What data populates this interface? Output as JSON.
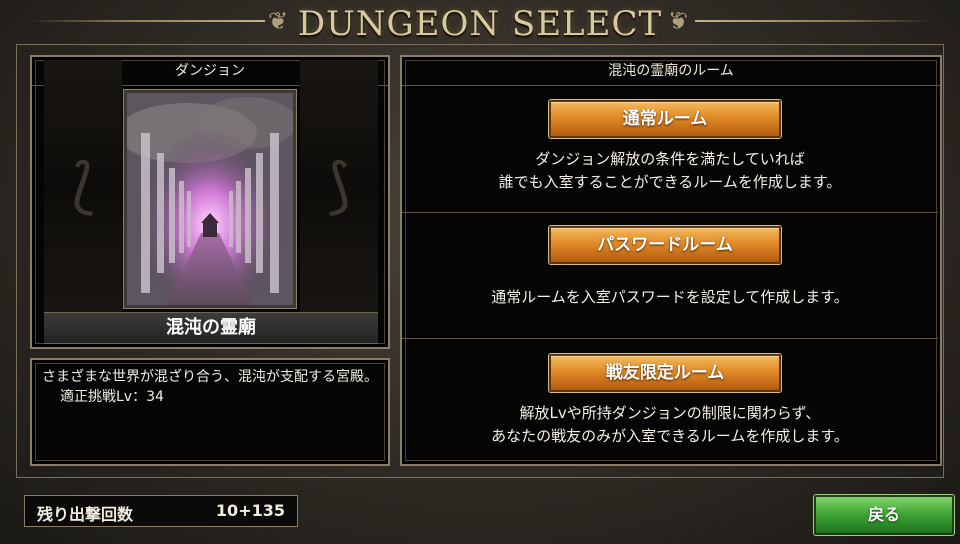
{
  "header": {
    "title": "DUNGEON SELECT"
  },
  "left_panel": {
    "header": "ダンジョン",
    "dungeon_name": "混沌の霊廟",
    "description": "さまざまな世界が混ざり合う、混沌が支配する宮殿。",
    "recommended_level": "適正挑戦Lv：34"
  },
  "right_panel": {
    "header": "混沌の霊廟のルーム",
    "rooms": [
      {
        "label": "通常ルーム",
        "desc_line1": "ダンジョン解放の条件を満たしていれば",
        "desc_line2": "誰でも入室することができるルームを作成します。"
      },
      {
        "label": "パスワードルーム",
        "desc_line1": "通常ルームを入室パスワードを設定して作成します。",
        "desc_line2": ""
      },
      {
        "label": "戦友限定ルーム",
        "desc_line1": "解放Lvや所持ダンジョンの制限に関わらず、",
        "desc_line2": "あなたの戦友のみが入室できるルームを作成します。"
      }
    ]
  },
  "footer": {
    "sortie_label": "残り出撃回数",
    "sortie_value": "10+135",
    "back_label": "戻る"
  },
  "colors": {
    "accent_orange": "#e08a26",
    "accent_green": "#3da332",
    "gold": "#d9c99d"
  }
}
